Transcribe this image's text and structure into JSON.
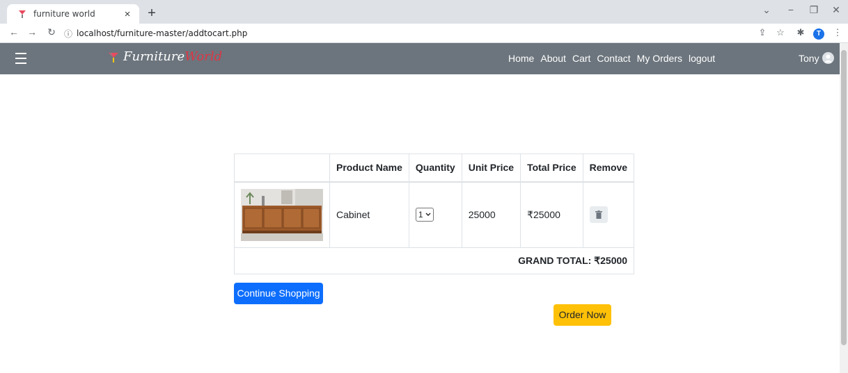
{
  "browser": {
    "tab_title": "furniture world",
    "tab_close": "×",
    "new_tab": "+",
    "url": "localhost/furniture-master/addtocart.php",
    "profile_initial": "T",
    "icons": [
      "info-icon",
      "share-icon",
      "star-icon",
      "extensions-icon",
      "menu-icon"
    ]
  },
  "navbar": {
    "brand_part1": "Furniture",
    "brand_part2": "World",
    "links": [
      "Home",
      "About",
      "Cart",
      "Contact",
      "My Orders",
      "logout"
    ],
    "user_name": "Tony",
    "bg_color": "#6c757d"
  },
  "cart": {
    "headers": [
      "",
      "Product Name",
      "Quantity",
      "Unit Price",
      "Total Price",
      "Remove"
    ],
    "items": [
      {
        "name": "Cabinet",
        "quantity": "1",
        "unit_price": "25000",
        "total_price": "₹25000"
      }
    ],
    "grand_total": "GRAND TOTAL: ₹25000"
  },
  "actions": {
    "continue_label": "Continue Shopping",
    "order_label": "Order Now",
    "continue_color": "#0d6efd",
    "order_color": "#ffc107"
  }
}
